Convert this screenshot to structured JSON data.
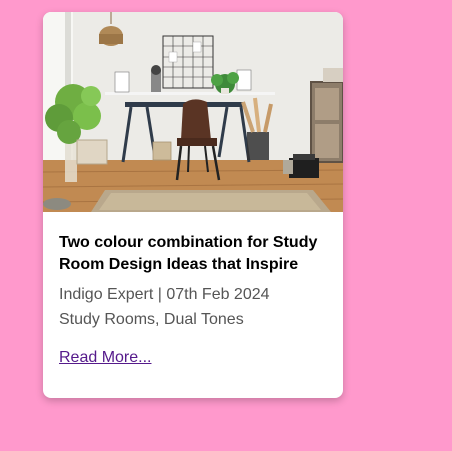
{
  "card": {
    "image_alt": "Study room with desk, chair, plants and wooden floor",
    "title": "Two colour combination for Study Room Design Ideas that Inspire",
    "meta": "Indigo Expert | 07th Feb 2024",
    "tags": "Study Rooms, Dual Tones",
    "read_more": "Read More..."
  },
  "colors": {
    "page_background": "#ff99cc",
    "card_background": "#ffffff",
    "title_text": "#000000",
    "meta_text": "#555555",
    "link_visited": "#551a8b"
  }
}
